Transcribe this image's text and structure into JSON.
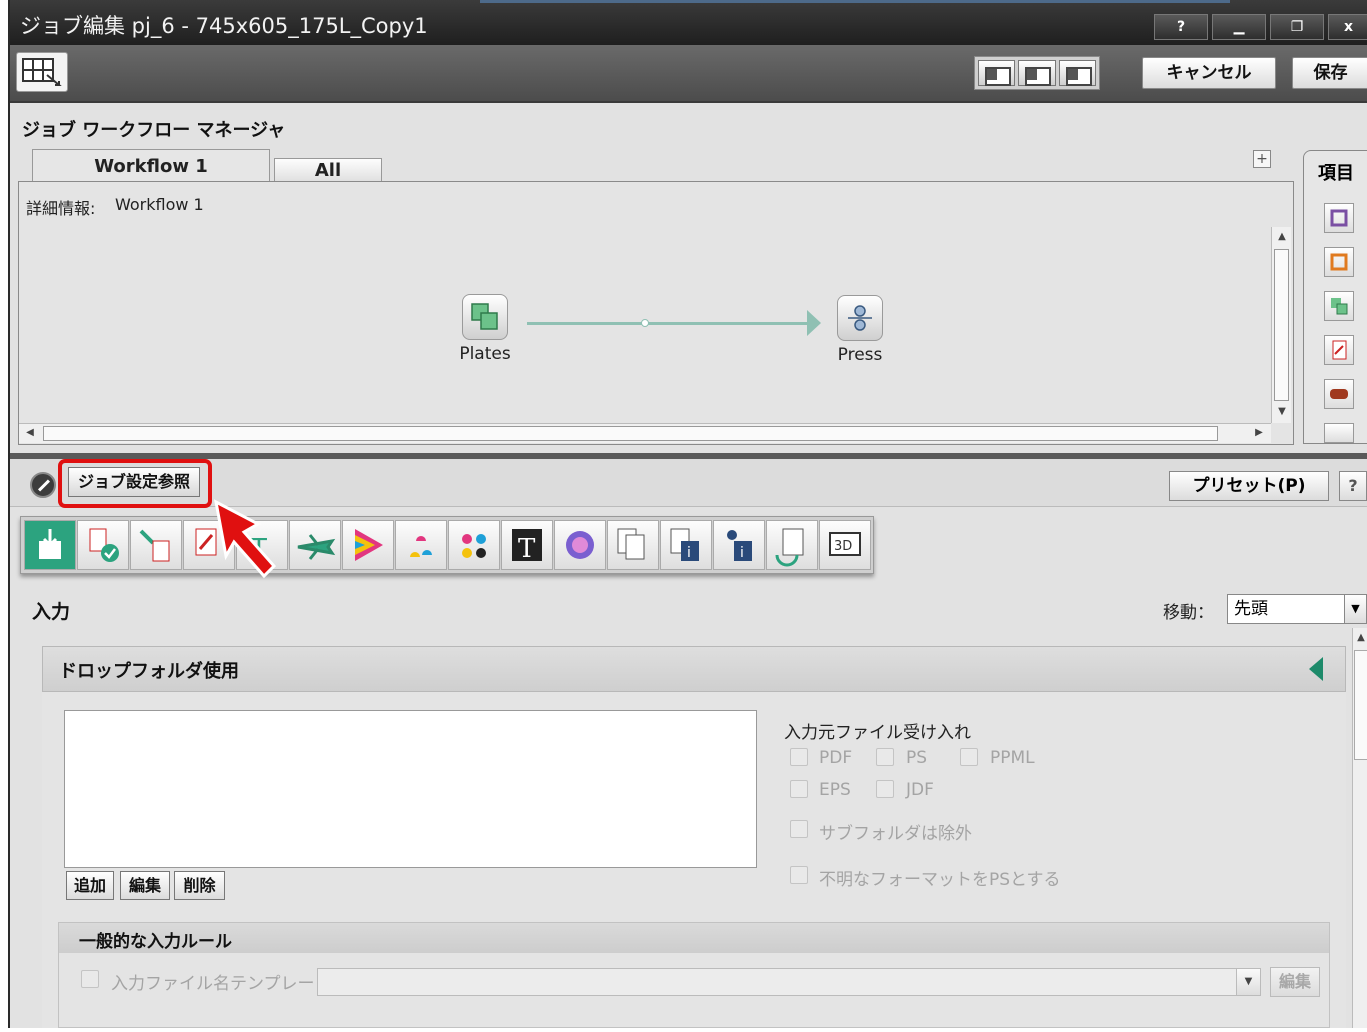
{
  "window": {
    "title": "ジョブ編集 pj_6 - 745x605_175L_Copy1",
    "help": "?",
    "minimize": "▁",
    "restore": "❐",
    "close": "x"
  },
  "toolbar": {
    "cancel_label": "キャンセル",
    "save_label": "保存",
    "layout_options": [
      "layout-1",
      "layout-2",
      "layout-3"
    ]
  },
  "workflow_manager": {
    "title": "ジョブ ワークフロー マネージャ",
    "tabs": [
      {
        "label": "Workflow 1",
        "active": true
      },
      {
        "label": "All",
        "active": false
      }
    ],
    "detail_label": "詳細情報:",
    "detail_value": "Workflow 1",
    "nodes": [
      {
        "label": "Plates",
        "icon": "plates-icon"
      },
      {
        "label": "Press",
        "icon": "press-icon"
      }
    ],
    "plus": "+",
    "items_title": "項目",
    "items_icons": [
      "hold-queue-icon",
      "process-queue-icon",
      "plates-item-icon",
      "pdf-item-icon",
      "press-item-icon",
      "document-item-icon"
    ]
  },
  "job_settings": {
    "ref_button_label": "ジョブ設定参照",
    "preset_label": "プリセット(P)",
    "help": "?",
    "tool_icons": [
      "input-icon",
      "preflight-icon",
      "normalize-icon",
      "pdf-edit-icon",
      "font-icon",
      "flight-icon",
      "color-icon",
      "ink-icon",
      "separation-icon",
      "text-icon",
      "color-management-icon",
      "pages-icon",
      "job-info-icon",
      "info-icon",
      "output-icon",
      "3d-icon"
    ],
    "highlight_color": "#e01010",
    "accent_color": "#2ca37f"
  },
  "input_section": {
    "title": "入力",
    "move_label": "移動：",
    "move_value": "先頭",
    "drop_folder_title": "ドロップフォルダ使用",
    "add_label": "追加",
    "edit_label": "編集",
    "delete_label": "削除",
    "accept_title": "入力元ファイル受け入れ",
    "file_types": [
      "PDF",
      "PS",
      "PPML",
      "EPS",
      "JDF"
    ],
    "exclude_subfolders": "サブフォルダは除外",
    "unknown_as_ps": "不明なフォーマットをPSとする",
    "rules_title": "一般的な入力ルール",
    "template_label": "入力ファイル名テンプレート",
    "template_edit": "編集"
  }
}
